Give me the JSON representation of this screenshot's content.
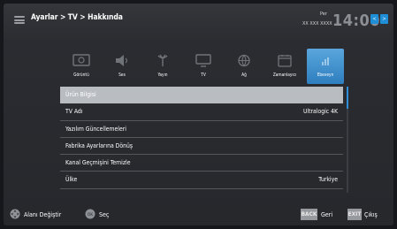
{
  "header": {
    "breadcrumb": "Ayarlar > TV > Hakkında",
    "day": "Per",
    "date": "XX XXX XXXX",
    "time": "14:00",
    "nav_buttons": [
      "<",
      ">"
    ]
  },
  "categories": [
    {
      "label": "Görüntü",
      "icon": "picture-icon"
    },
    {
      "label": "Ses",
      "icon": "speaker-icon"
    },
    {
      "label": "Yayın",
      "icon": "antenna-icon"
    },
    {
      "label": "TV",
      "icon": "tv-icon"
    },
    {
      "label": "Ağ",
      "icon": "globe-icon"
    },
    {
      "label": "Zamanlayıcı",
      "icon": "timer-icon"
    },
    {
      "label": "Ebeveyn",
      "icon": "parental-icon"
    }
  ],
  "active_category": "Ebeveyn",
  "menu": {
    "rows": [
      {
        "label": "Ürün Bilgisi",
        "value": "",
        "selected": true
      },
      {
        "label": "TV Adı",
        "value": "Ultralogic 4K"
      },
      {
        "label": "Yazılım Güncellemeleri",
        "value": ""
      },
      {
        "label": "Fabrika Ayarlarına Dönüş",
        "value": ""
      },
      {
        "label": "Kanal Geçmişini Temizle",
        "value": ""
      },
      {
        "label": "Ülke",
        "value": "Turkiye"
      }
    ]
  },
  "footer": {
    "change_area": "Alanı Değiştir",
    "ok_key": "OK",
    "select": "Seç",
    "back_key": "BACK",
    "back": "Geri",
    "exit_key": "EXIT",
    "exit": "Çıkış"
  },
  "colors": {
    "accent": "#2e8fd8",
    "selected_row": "#b9bcc1",
    "background": "#2b2d32"
  }
}
